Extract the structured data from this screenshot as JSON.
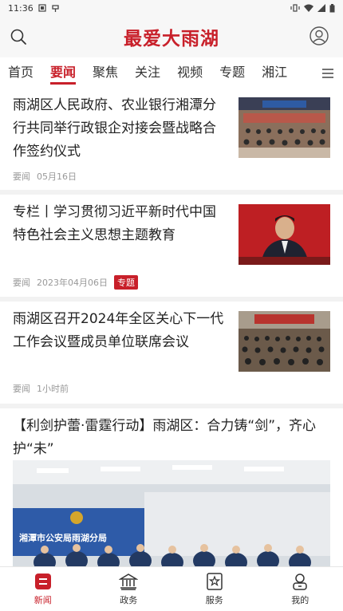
{
  "status_bar": {
    "time": "11:36"
  },
  "header": {
    "logo_text": "最爱大雨湖"
  },
  "tabs": [
    {
      "label": "首页",
      "active": false
    },
    {
      "label": "要闻",
      "active": true
    },
    {
      "label": "聚焦",
      "active": false
    },
    {
      "label": "关注",
      "active": false
    },
    {
      "label": "视频",
      "active": false
    },
    {
      "label": "专题",
      "active": false
    },
    {
      "label": "湘江",
      "active": false
    }
  ],
  "articles": [
    {
      "title": "雨湖区人民政府、农业银行湘潭分行共同举行政银企对接会暨战略合作签约仪式",
      "category": "要闻",
      "date": "05月16日"
    },
    {
      "title": "专栏丨学习贯彻习近平新时代中国特色社会主义思想主题教育",
      "category": "要闻",
      "date": "2023年04月06日",
      "tag": "专题"
    },
    {
      "title": "雨湖区召开2024年全区关心下一代工作会议暨成员单位联席会议",
      "category": "要闻",
      "date": "1小时前"
    },
    {
      "title": "【利剑护蕾·雷霆行动】雨湖区：合力铸“剑”，齐心护“未”",
      "image_caption": "湘潭市公安局雨湖分局"
    }
  ],
  "bottom_nav": [
    {
      "label": "新闻",
      "active": true
    },
    {
      "label": "政务",
      "active": false
    },
    {
      "label": "服务",
      "active": false
    },
    {
      "label": "我的",
      "active": false
    }
  ],
  "colors": {
    "accent": "#c8202a"
  }
}
